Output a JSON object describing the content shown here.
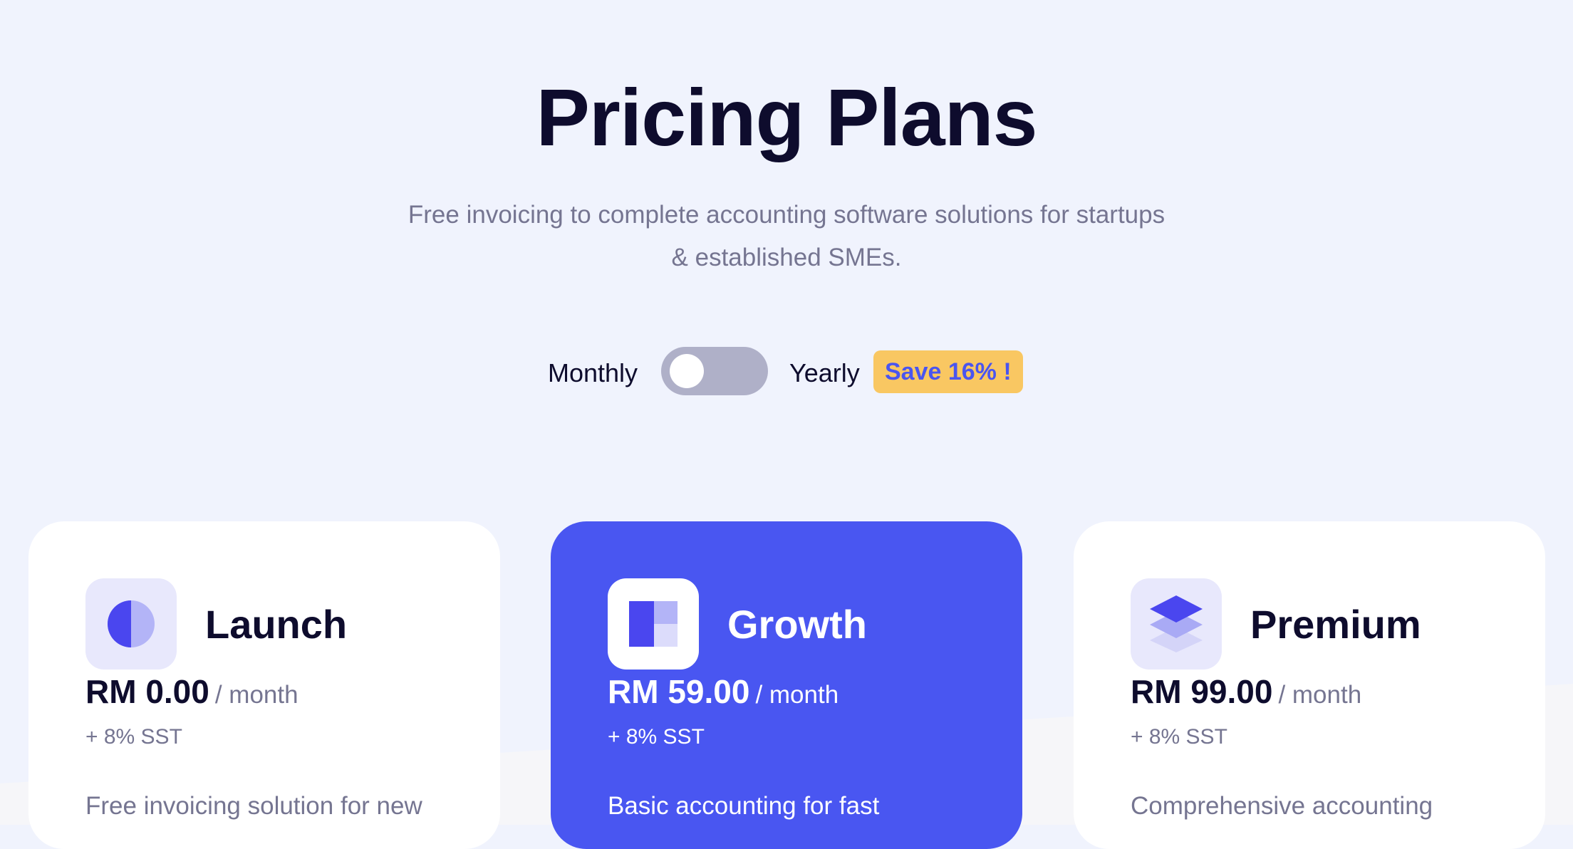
{
  "header": {
    "title": "Pricing Plans",
    "subtitle": "Free invoicing to complete accounting software solutions for startups & established SMEs."
  },
  "billing_toggle": {
    "monthly_label": "Monthly",
    "yearly_label": "Yearly",
    "save_badge": "Save 16% !",
    "selected": "Monthly"
  },
  "plans": [
    {
      "name": "Launch",
      "price": "RM 0.00",
      "period": "/ month",
      "tax": "+ 8% SST",
      "description": "Free invoicing solution for new",
      "icon": "half-circle-icon",
      "featured": false
    },
    {
      "name": "Growth",
      "price": "RM 59.00",
      "period": "/ month",
      "tax": "+ 8% SST",
      "description": "Basic accounting for fast",
      "icon": "layout-blocks-icon",
      "featured": true
    },
    {
      "name": "Premium",
      "price": "RM 99.00",
      "period": "/ month",
      "tax": "+ 8% SST",
      "description": "Comprehensive accounting",
      "icon": "layered-cube-icon",
      "featured": false
    }
  ],
  "colors": {
    "background": "#f0f3fd",
    "accent": "#4956f1",
    "heading": "#0e0c2d",
    "muted_text": "#757591",
    "badge": "#f9c762",
    "toggle_track": "#afb0c8"
  }
}
